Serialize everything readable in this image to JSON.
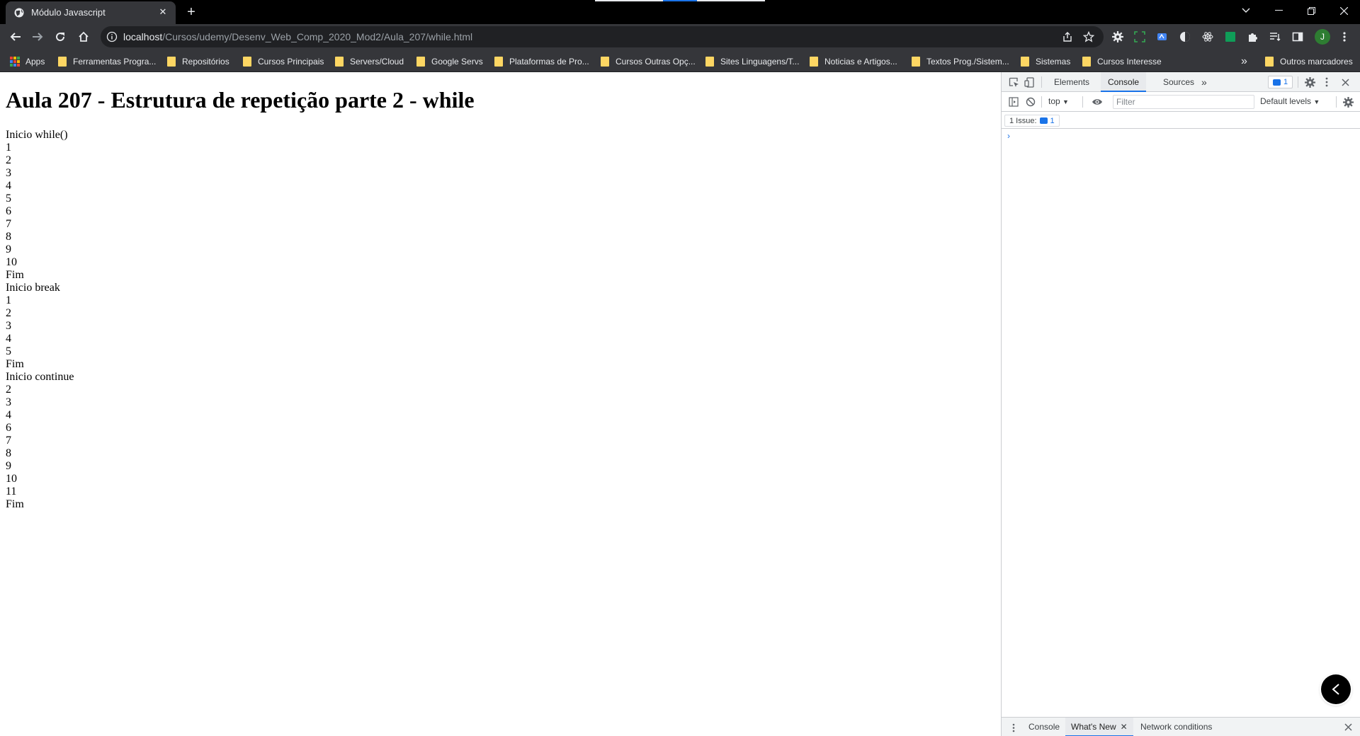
{
  "browser": {
    "tab_title": "Módulo Javascript",
    "tab_close_glyph": "✕",
    "new_tab_glyph": "+",
    "address": {
      "host": "localhost",
      "path": "/Cursos/udemy/Desenv_Web_Comp_2020_Mod2/Aula_207/while.html"
    },
    "profile_initial": "J",
    "bookmarks": [
      "Apps",
      "Ferramentas Progra...",
      "Repositórios",
      "Cursos Principais",
      "Servers/Cloud",
      "Google Servs",
      "Plataformas de Pro...",
      "Cursos Outras Opç...",
      "Sites Linguagens/T...",
      "Noticias e Artigos...",
      "Textos Prog./Sistem...",
      "Sistemas",
      "Cursos Interesse"
    ],
    "bookmarks_overflow": "»",
    "other_bookmarks": "Outros marcadores"
  },
  "page": {
    "heading": "Aula 207 - Estrutura de repetição parte 2 - while",
    "output_lines": [
      "Inicio while()",
      "1",
      "2",
      "3",
      "4",
      "5",
      "6",
      "7",
      "8",
      "9",
      "10",
      "Fim",
      "Inicio break",
      "1",
      "2",
      "3",
      "4",
      "5",
      "Fim",
      "Inicio continue",
      "2",
      "3",
      "4",
      "6",
      "7",
      "8",
      "9",
      "10",
      "11",
      "Fim"
    ]
  },
  "devtools": {
    "tabs": [
      "Elements",
      "Console",
      "Sources"
    ],
    "active_tab": "Console",
    "more_tabs_glyph": "»",
    "message_count": "1",
    "context": "top",
    "filter_placeholder": "Filter",
    "levels": "Default levels",
    "issues_label": "1 Issue:",
    "issues_count": "1",
    "prompt_glyph": "›",
    "drawer_tabs": [
      "Console",
      "What's New",
      "Network conditions"
    ],
    "drawer_active": "What's New",
    "drawer_close_glyph": "✕"
  },
  "colors": {
    "titlebar": "#000000",
    "toolbar": "#35363a",
    "omnibox": "#202124",
    "bookmark_folder": "#fdd663",
    "accent": "#1a73e8",
    "devtools_bg": "#f1f3f4"
  },
  "icons": {
    "back": "arrow-left-icon",
    "forward": "arrow-right-icon",
    "reload": "reload-icon",
    "home": "home-icon",
    "info": "info-icon",
    "share": "share-icon",
    "star": "star-icon",
    "extensions": "puzzle-icon",
    "sidepanel": "side-panel-icon",
    "menu": "kebab-menu-icon"
  }
}
